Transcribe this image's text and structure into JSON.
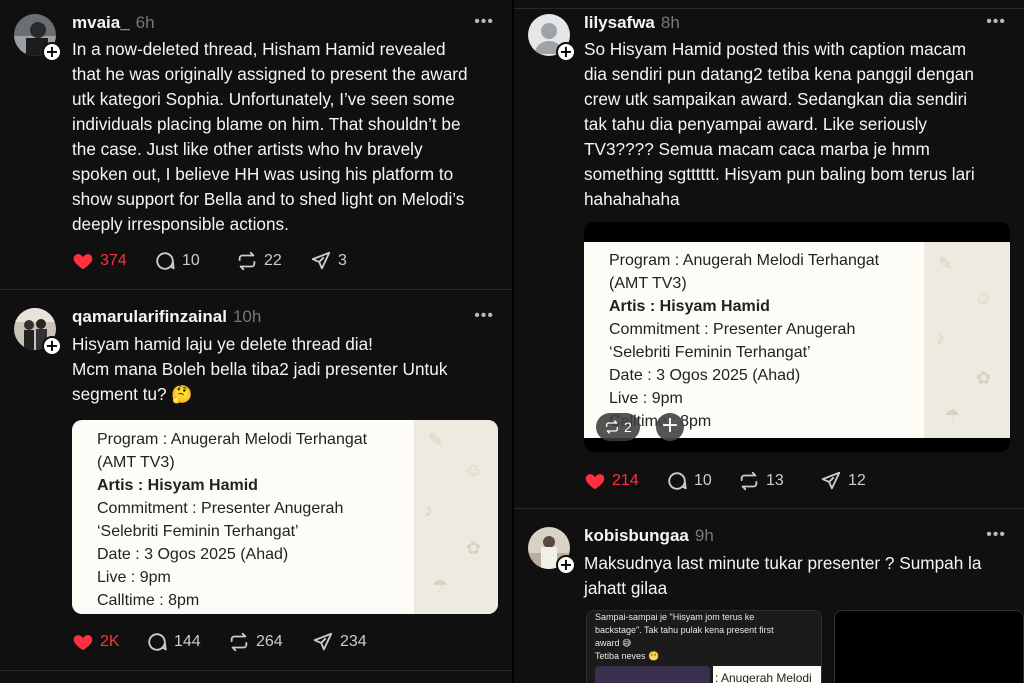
{
  "colors": {
    "background": "#101010",
    "like_active": "#ff3040",
    "text": "#f3f5f7",
    "muted": "#777777"
  },
  "left_column": {
    "post1": {
      "username": "mvaia_",
      "time": "6h",
      "more": "•••",
      "lines": [
        "In a now-deleted thread, Hisham Hamid revealed",
        "that he was originally assigned to present the award",
        "utk kategori Sophia. Unfortunately, I’ve seen some",
        "individuals placing blame on him. That shouldn’t be",
        "the case. Just like other artists who hv bravely",
        "spoken out, I believe HH was using his platform to",
        "show support for Bella and to shed light on Melodi’s",
        "deeply irresponsible actions."
      ],
      "likes": "374",
      "replies": "10",
      "reposts": "22",
      "shares": "3"
    },
    "post2": {
      "username": "qamarularifinzainal",
      "time": "10h",
      "more": "•••",
      "lines": [
        "Hisyam hamid laju ye delete thread dia!",
        "Mcm mana Boleh bella tiba2 jadi presenter Untuk",
        "segment tu? 🤔"
      ],
      "card_lines": [
        "Program : Anugerah Melodi Terhangat",
        "(AMT TV3)",
        "Artis : Hisyam Hamid",
        "Commitment : Presenter Anugerah",
        "‘Selebriti Feminin Terhangat’",
        "Date : 3 Ogos 2025 (Ahad)",
        "Live : 9pm",
        "Calltime : 8pm"
      ],
      "likes": "2K",
      "replies": "144",
      "reposts": "264",
      "shares": "234"
    }
  },
  "right_column": {
    "post1": {
      "username": "lilysafwa",
      "time": "8h",
      "more": "•••",
      "lines": [
        "So Hisyam Hamid posted this with caption macam",
        "dia sendiri pun datang2 tetiba kena panggil dengan",
        "crew utk sampaikan award. Sedangkan dia sendiri",
        "tak tahu dia penyampai award. Like seriously",
        "TV3???? Semua macam caca marba je hmm",
        "something sgtttttt. Hisyam pun baling bom terus lari",
        "hahahahaha"
      ],
      "card_lines": [
        "Program : Anugerah Melodi Terhangat",
        "(AMT TV3)",
        "Artis : Hisyam Hamid",
        "Commitment : Presenter Anugerah",
        "‘Selebriti Feminin Terhangat’",
        "Date : 3 Ogos 2025 (Ahad)",
        "Live : 9pm",
        "Calltime : 8pm"
      ],
      "overlay_count": "2",
      "likes": "214",
      "replies": "10",
      "reposts": "13",
      "shares": "12"
    },
    "post2": {
      "username": "kobisbungaa",
      "time": "9h",
      "more": "•••",
      "lines": [
        "Maksudnya last minute tukar presenter ? Sumpah la",
        "jahatt gilaa"
      ],
      "thumb_lines": [
        "Sampai-sampai je \"Hisyam jom terus ke",
        "backstage\". Tak tahu pulak kena present first",
        "award 😅",
        "Tetiba neves 😬"
      ],
      "thumb_inner": ": Anugerah Melodi"
    }
  }
}
